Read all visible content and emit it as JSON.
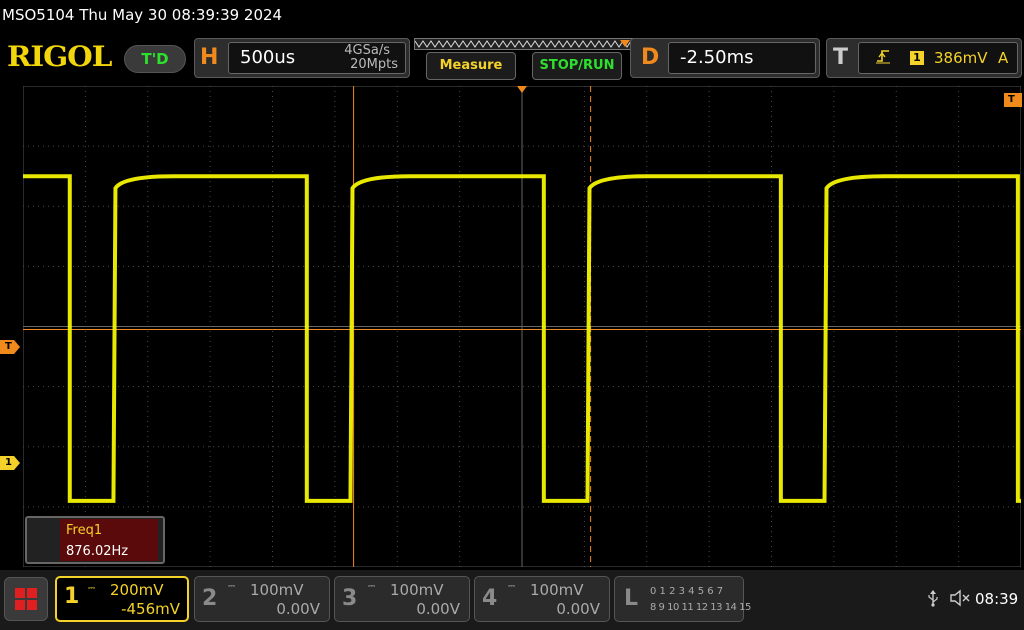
{
  "header": {
    "title": "MSO5104  Thu May 30 08:39:39 2024",
    "logo": "RIGOL",
    "run_mode": "T'D"
  },
  "horizontal": {
    "letter": "H",
    "timebase": "500us",
    "sample_rate": "4GSa/s",
    "memory_depth": "20Mpts"
  },
  "buttons": {
    "measure": "Measure",
    "stop_run": "STOP/RUN"
  },
  "delay": {
    "letter": "D",
    "value": "-2.50ms"
  },
  "trigger": {
    "letter": "T",
    "edge_icon": "rising-edge-icon",
    "channel": "1",
    "level": "386mV",
    "mode": "A"
  },
  "markers": {
    "trigger_right": "T",
    "trigger_left": "T",
    "ch1": "1"
  },
  "waveform": {
    "channel": 1,
    "color": "#f4f400",
    "high_divs": 6.5,
    "low_divs": 1.1,
    "rising_edges_divs": [
      1.45,
      5.25,
      9.05,
      12.85
    ],
    "falling_edges_divs": [
      0.75,
      4.55,
      8.35,
      12.15,
      15.95
    ]
  },
  "grid": {
    "h_divs": 16,
    "v_divs": 8,
    "grid_color": "#4a4a4a",
    "trigger_level_divs": 3.95,
    "cursor_divs": [
      5.3,
      9.1
    ]
  },
  "measurement": {
    "name": "Freq1",
    "value": "876.02Hz"
  },
  "channels": [
    {
      "number": "1",
      "coupling": "⎓",
      "scale": "200mV",
      "offset": "-456mV",
      "active": true
    },
    {
      "number": "2",
      "coupling": "⎓",
      "scale": "100mV",
      "offset": "0.00V",
      "active": false
    },
    {
      "number": "3",
      "coupling": "⎓",
      "scale": "100mV",
      "offset": "0.00V",
      "active": false
    },
    {
      "number": "4",
      "coupling": "⎓",
      "scale": "100mV",
      "offset": "0.00V",
      "active": false
    }
  ],
  "logic": {
    "letter": "L",
    "row1": "0 1 2 3   4 5 6 7",
    "row2": "8 9 10 11 12 13 14 15"
  },
  "status": {
    "usb_icon": "usb-icon",
    "speaker_icon": "speaker-muted-icon",
    "time": "08:39"
  },
  "colors": {
    "ch1": "#f4d22a",
    "accent": "#f08a1c",
    "run_green": "#2ee02e"
  }
}
